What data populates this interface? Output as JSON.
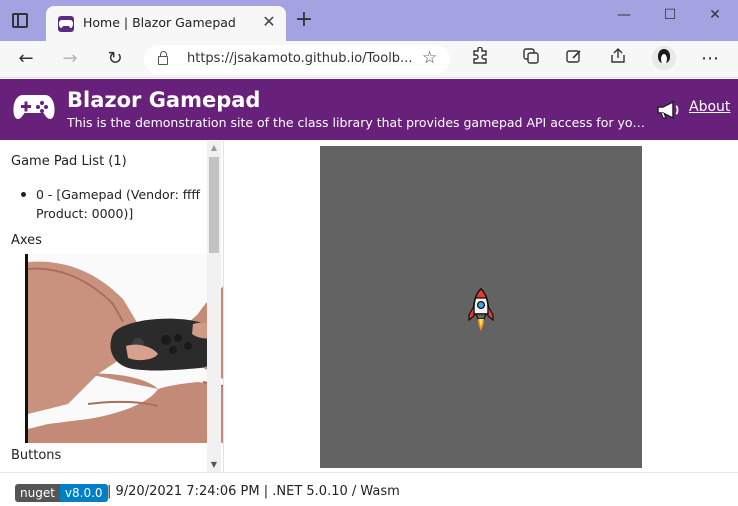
{
  "browser": {
    "tab_title": "Home | Blazor Gamepad",
    "tab_close": "✕",
    "new_tab": "+",
    "url": "https://jsakamoto.github.io/Toolb...",
    "min": "—",
    "max": "☐",
    "close": "✕",
    "back": "←",
    "forward": "→",
    "reload": "↻",
    "more": "⋯"
  },
  "header": {
    "title": "Blazor Gamepad",
    "subtitle": "This is the demonstration site of the class library that provides gamepad API access for you...",
    "about_label": "About"
  },
  "left_panel": {
    "gamepad_list_title": "Game Pad List (1)",
    "gamepads": [
      "0 - [Gamepad (Vendor: ffff Product: 0000)]"
    ],
    "axes_title": "Axes",
    "buttons_title": "Buttons"
  },
  "footer": {
    "badge_label": "nuget",
    "badge_version": "v8.0.0",
    "info": "| 9/20/2021 7:24:06 PM | .NET 5.0.10 / Wasm"
  },
  "colors": {
    "header_bg": "#68217a",
    "titlebar_bg": "#a3a3e1",
    "stage_bg": "#636363",
    "badge_version_bg": "#007ec6"
  }
}
